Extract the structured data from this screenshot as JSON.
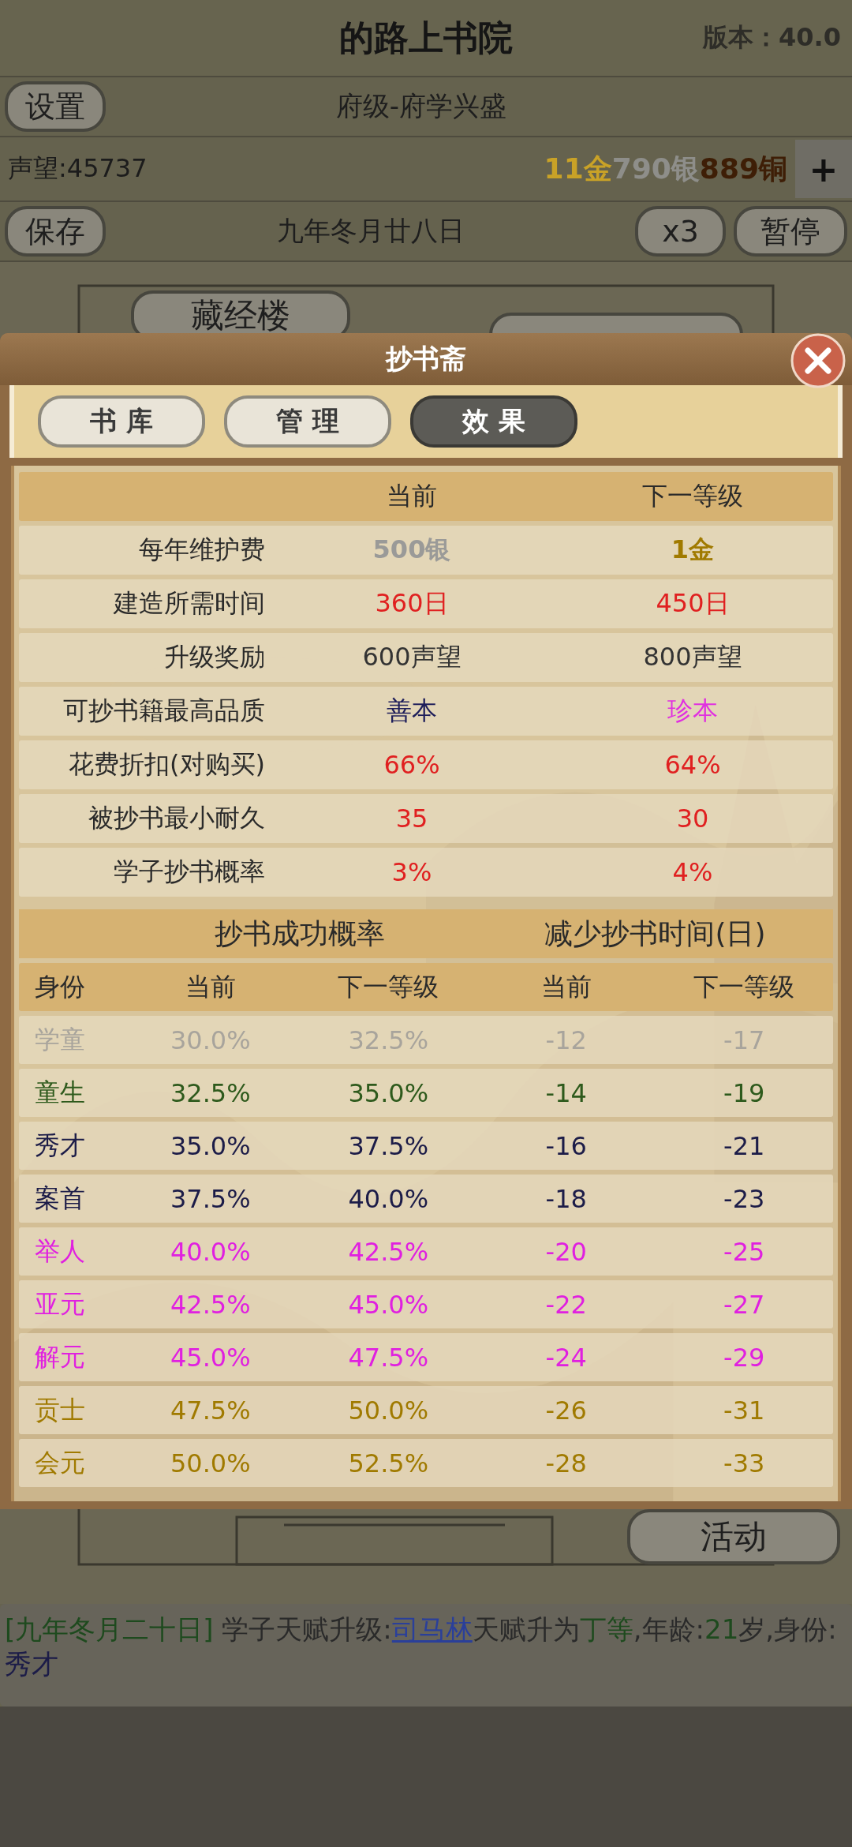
{
  "header": {
    "title": "的路上书院",
    "version": "版本：40.0"
  },
  "level_bar": {
    "settings_button": "设置",
    "rank": "府级-府学兴盛"
  },
  "resources": {
    "reputation": "声望:45737",
    "money": [
      {
        "text": "11金",
        "color": "#c9a227"
      },
      {
        "text": "790银",
        "color": "#8e8e8a"
      },
      {
        "text": "889铜",
        "color": "#3e1e06"
      }
    ],
    "add_button": "+"
  },
  "time_bar": {
    "save_button": "保存",
    "date": "九年冬月廿八日",
    "speed_button": "x3",
    "pause_button": "暂停"
  },
  "scene_buttons": [
    {
      "label": "藏经楼"
    },
    {
      "label": "活动"
    }
  ],
  "dialog": {
    "title": "抄书斋",
    "tabs": [
      {
        "label": "书 库",
        "selected": false
      },
      {
        "label": "管 理",
        "selected": false
      },
      {
        "label": "效 果",
        "selected": true
      }
    ],
    "stats": {
      "columns": [
        "当前",
        "下一等级"
      ],
      "rows": [
        {
          "kind": "money",
          "label": "每年维护费",
          "current": {
            "text": "500银",
            "color": "#9a9a98"
          },
          "next": {
            "text": "1金",
            "color": "#a07a00"
          }
        },
        {
          "kind": "plain",
          "label": "建造所需时间",
          "current": {
            "text": "360日",
            "color": "#e02020"
          },
          "next": {
            "text": "450日",
            "color": "#e02020"
          }
        },
        {
          "kind": "plain",
          "label": "升级奖励",
          "current": {
            "text": "600声望",
            "color": "#333333"
          },
          "next": {
            "text": "800声望",
            "color": "#333333"
          }
        },
        {
          "kind": "plain",
          "label": "可抄书籍最高品质",
          "current": {
            "text": "善本",
            "color": "#1e1e5a"
          },
          "next": {
            "text": "珍本",
            "color": "#e030e0"
          }
        },
        {
          "kind": "plain",
          "label": "花费折扣(对购买)",
          "current": {
            "text": "66%",
            "color": "#e02020"
          },
          "next": {
            "text": "64%",
            "color": "#e02020"
          }
        },
        {
          "kind": "plain",
          "label": "被抄书最小耐久",
          "current": {
            "text": "35",
            "color": "#e02020"
          },
          "next": {
            "text": "30",
            "color": "#e02020"
          }
        },
        {
          "kind": "plain",
          "label": "学子抄书概率",
          "current": {
            "text": "3%",
            "color": "#e02020"
          },
          "next": {
            "text": "4%",
            "color": "#e02020"
          }
        }
      ]
    },
    "ranks": {
      "groups": [
        "抄书成功概率",
        "减少抄书时间(日)"
      ],
      "columns": [
        "身份",
        "当前",
        "下一等级",
        "当前",
        "下一等级"
      ],
      "rows": [
        {
          "color": "#a8a49c",
          "cells": [
            "学童",
            "30.0%",
            "32.5%",
            "-12",
            "-17"
          ]
        },
        {
          "color": "#2e5a1c",
          "cells": [
            "童生",
            "32.5%",
            "35.0%",
            "-14",
            "-19"
          ]
        },
        {
          "color": "#1c1c48",
          "cells": [
            "秀才",
            "35.0%",
            "37.5%",
            "-16",
            "-21"
          ]
        },
        {
          "color": "#1c1c48",
          "cells": [
            "案首",
            "37.5%",
            "40.0%",
            "-18",
            "-23"
          ]
        },
        {
          "color": "#e020e0",
          "cells": [
            "举人",
            "40.0%",
            "42.5%",
            "-20",
            "-25"
          ]
        },
        {
          "color": "#e020e0",
          "cells": [
            "亚元",
            "42.5%",
            "45.0%",
            "-22",
            "-27"
          ]
        },
        {
          "color": "#e020e0",
          "cells": [
            "解元",
            "45.0%",
            "47.5%",
            "-24",
            "-29"
          ]
        },
        {
          "color": "#a07a00",
          "cells": [
            "贡士",
            "47.5%",
            "50.0%",
            "-26",
            "-31"
          ]
        },
        {
          "color": "#a07a00",
          "cells": [
            "会元",
            "50.0%",
            "52.5%",
            "-28",
            "-33"
          ]
        }
      ]
    }
  },
  "log": [
    {
      "kind": "text",
      "text": "[九年冬月二十日]",
      "color": "#1e4a1e"
    },
    {
      "kind": "text",
      "text": " 学子天赋升级:",
      "color": "#2a2a2a"
    },
    {
      "kind": "link",
      "text": "司马林",
      "color": "#2a3f9a"
    },
    {
      "kind": "text",
      "text": "天赋升为",
      "color": "#2a2a2a"
    },
    {
      "kind": "text",
      "text": "丁等",
      "color": "#1e4a1e"
    },
    {
      "kind": "text",
      "text": ",年龄:",
      "color": "#2a2a2a"
    },
    {
      "kind": "text",
      "text": "21",
      "color": "#1e4a1e"
    },
    {
      "kind": "text",
      "text": "岁,身份:",
      "color": "#2a2a2a"
    },
    {
      "kind": "text",
      "text": "秀才",
      "color": "#1c1c48"
    }
  ]
}
